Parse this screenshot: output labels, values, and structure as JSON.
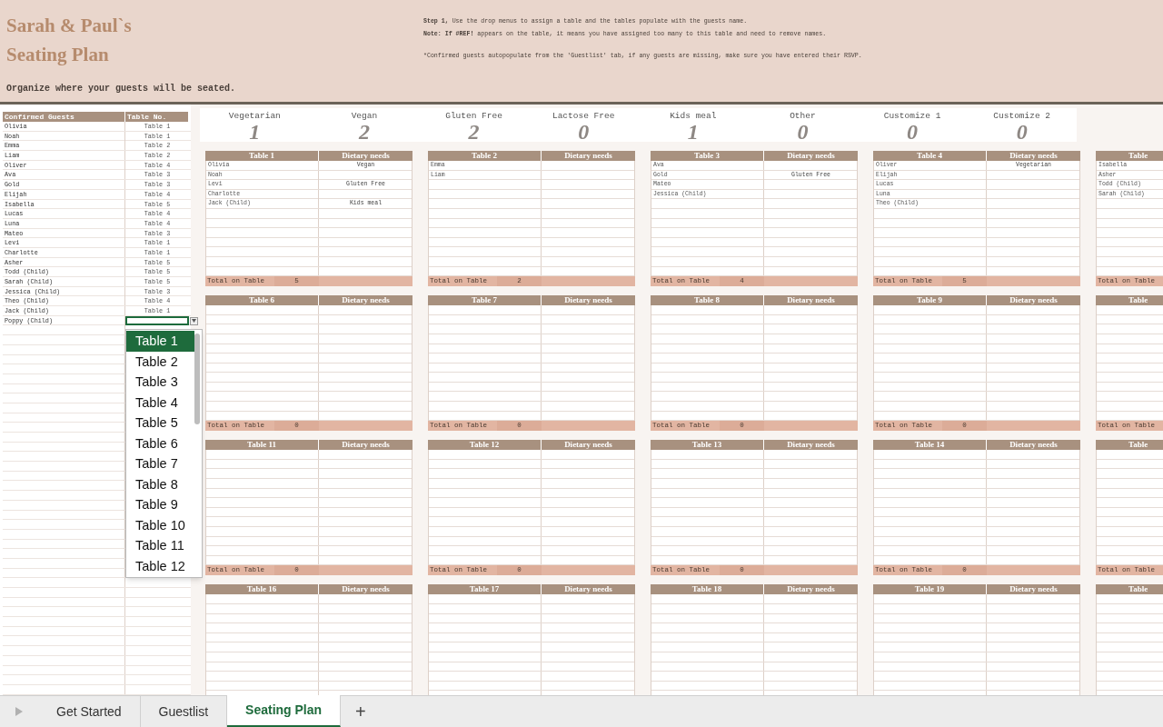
{
  "header": {
    "title_lines": [
      "Sarah & Paul`s",
      "Seating Plan"
    ],
    "subtitle": "Organize where your guests will be seated.",
    "instructions": [
      "**Step 1,** Use the drop menus to assign a table and the tables populate with the guests name.",
      "**Note: If #REF!** appears on the table, it means you have assigned too many to this table and need to remove names.",
      "*Confirmed guests autopopulate from the 'Guestlist' tab, if any guests are missing, make sure you have entered their RSVP."
    ]
  },
  "guest_list": {
    "columns": [
      "Confirmed Guests",
      "Table No."
    ],
    "rows": [
      {
        "name": "Olivia",
        "table": "Table 1",
        "selected": false
      },
      {
        "name": "Noah",
        "table": "Table 1",
        "selected": false
      },
      {
        "name": "Emma",
        "table": "Table 2",
        "selected": false
      },
      {
        "name": "Liam",
        "table": "Table 2",
        "selected": false
      },
      {
        "name": "Oliver",
        "table": "Table 4",
        "selected": false
      },
      {
        "name": "Ava",
        "table": "Table 3",
        "selected": false
      },
      {
        "name": "Gold",
        "table": "Table 3",
        "selected": false
      },
      {
        "name": "Elijah",
        "table": "Table 4",
        "selected": false
      },
      {
        "name": "Isabella",
        "table": "Table 5",
        "selected": false
      },
      {
        "name": "Lucas",
        "table": "Table 4",
        "selected": false
      },
      {
        "name": "Luna",
        "table": "Table 4",
        "selected": false
      },
      {
        "name": "Mateo",
        "table": "Table 3",
        "selected": false
      },
      {
        "name": "Levi",
        "table": "Table 1",
        "selected": false
      },
      {
        "name": "Charlotte",
        "table": "Table 1",
        "selected": false
      },
      {
        "name": "Asher",
        "table": "Table 5",
        "selected": false
      },
      {
        "name": "Todd (Child)",
        "table": "Table 5",
        "selected": false
      },
      {
        "name": "Sarah (Child)",
        "table": "Table 5",
        "selected": false
      },
      {
        "name": "Jessica (Child)",
        "table": "Table 3",
        "selected": false
      },
      {
        "name": "Theo (Child)",
        "table": "Table 4",
        "selected": false
      },
      {
        "name": "Jack (Child)",
        "table": "Table 1",
        "selected": false
      },
      {
        "name": "Poppy (Child)",
        "selected": true
      }
    ]
  },
  "dropdown": {
    "options": [
      {
        "label": "Table 1",
        "selected": true
      },
      {
        "label": "Table 2",
        "selected": false
      },
      {
        "label": "Table 3",
        "selected": false
      },
      {
        "label": "Table 4",
        "selected": false
      },
      {
        "label": "Table 5",
        "selected": false
      },
      {
        "label": "Table 6",
        "selected": false
      },
      {
        "label": "Table 7",
        "selected": false
      },
      {
        "label": "Table 8",
        "selected": false
      },
      {
        "label": "Table 9",
        "selected": false
      },
      {
        "label": "Table 10",
        "selected": false
      },
      {
        "label": "Table 11",
        "selected": false
      },
      {
        "label": "Table 12",
        "selected": false
      }
    ]
  },
  "dietary_summary": [
    {
      "label": "Vegetarian",
      "count": "1"
    },
    {
      "label": "Vegan",
      "count": "2"
    },
    {
      "label": "Gluten Free",
      "count": "2"
    },
    {
      "label": "Lactose Free",
      "count": "0"
    },
    {
      "label": "Kids meal",
      "count": "1"
    },
    {
      "label": "Other",
      "count": "0"
    },
    {
      "label": "Customize 1",
      "count": "0"
    },
    {
      "label": "Customize 2",
      "count": "0"
    }
  ],
  "tables": [
    {
      "kind": "full",
      "title": "Table 1",
      "diet_header": "Dietary needs",
      "rows": [
        {
          "name": "Olivia",
          "diet": "Vegan"
        },
        {
          "name": "Noah"
        },
        {
          "name": "Levi",
          "diet": "Gluten Free"
        },
        {
          "name": "Charlotte"
        },
        {
          "name": "Jack (Child)",
          "diet": "Kids meal"
        }
      ],
      "total_label": "Total on Table",
      "total": "5"
    },
    {
      "kind": "full",
      "title": "Table 2",
      "diet_header": "Dietary needs",
      "rows": [
        {
          "name": "Emma"
        },
        {
          "name": "Liam"
        }
      ],
      "total_label": "Total on Table",
      "total": "2"
    },
    {
      "kind": "full",
      "title": "Table 3",
      "diet_header": "Dietary needs",
      "rows": [
        {
          "name": "Ava"
        },
        {
          "name": "Gold",
          "diet": "Gluten Free"
        },
        {
          "name": "Mateo"
        },
        {
          "name": "Jessica (Child)"
        }
      ],
      "total_label": "Total on Table",
      "total": "4"
    },
    {
      "kind": "full",
      "title": "Table 4",
      "diet_header": "Dietary needs",
      "rows": [
        {
          "name": "Oliver",
          "diet": "Vegetarian"
        },
        {
          "name": "Elijah"
        },
        {
          "name": "Lucas"
        },
        {
          "name": "Luna"
        },
        {
          "name": "Theo (Child)"
        }
      ],
      "total_label": "Total on Table",
      "total": "5"
    },
    {
      "kind": "partial",
      "title": "Table",
      "rows": [
        {
          "name": "Isabella"
        },
        {
          "name": "Asher"
        },
        {
          "name": "Todd (Child)"
        },
        {
          "name": "Sarah (Child)"
        }
      ],
      "total_label": "Total on Table"
    },
    {
      "kind": "full",
      "title": "Table 6",
      "diet_header": "Dietary needs",
      "total_label": "Total on Table",
      "total": "0"
    },
    {
      "kind": "full",
      "title": "Table 7",
      "diet_header": "Dietary needs",
      "total_label": "Total on Table",
      "total": "0"
    },
    {
      "kind": "full",
      "title": "Table 8",
      "diet_header": "Dietary needs",
      "total_label": "Total on Table",
      "total": "0"
    },
    {
      "kind": "full",
      "title": "Table 9",
      "diet_header": "Dietary needs",
      "total_label": "Total on Table",
      "total": "0"
    },
    {
      "kind": "partial",
      "title": "Table",
      "total_label": "Total on Table"
    },
    {
      "kind": "full",
      "title": "Table 11",
      "diet_header": "Dietary needs",
      "total_label": "Total on Table",
      "total": "0"
    },
    {
      "kind": "full",
      "title": "Table 12",
      "diet_header": "Dietary needs",
      "total_label": "Total on Table",
      "total": "0"
    },
    {
      "kind": "full",
      "title": "Table 13",
      "diet_header": "Dietary needs",
      "total_label": "Total on Table",
      "total": "0"
    },
    {
      "kind": "full",
      "title": "Table 14",
      "diet_header": "Dietary needs",
      "total_label": "Total on Table",
      "total": "0"
    },
    {
      "kind": "partial",
      "title": "Table",
      "total_label": "Total on Table"
    },
    {
      "kind": "full",
      "title": "Table 16",
      "diet_header": "Dietary needs"
    },
    {
      "kind": "full",
      "title": "Table 17",
      "diet_header": "Dietary needs"
    },
    {
      "kind": "full",
      "title": "Table 18",
      "diet_header": "Dietary needs"
    },
    {
      "kind": "full",
      "title": "Table 19",
      "diet_header": "Dietary needs"
    },
    {
      "kind": "partial",
      "title": "Table"
    }
  ],
  "sheet_tabs": [
    {
      "label": "Get Started",
      "selected": false
    },
    {
      "label": "Guestlist",
      "selected": false
    },
    {
      "label": "Seating Plan",
      "selected": true
    }
  ],
  "add_sheet": "+"
}
